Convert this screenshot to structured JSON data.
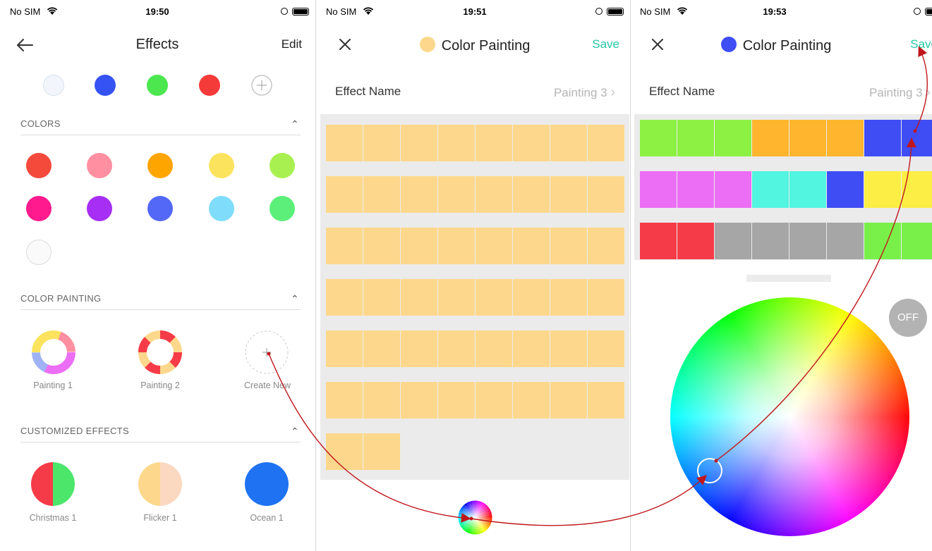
{
  "screen1": {
    "status": {
      "carrier": "No SIM",
      "time": "19:50"
    },
    "nav": {
      "title": "Effects",
      "edit_label": "Edit"
    },
    "top_swatches": [
      "#f2f6fc",
      "#3553f3",
      "#4ce64f",
      "#f53a3a"
    ],
    "colors_section": {
      "title": "COLORS"
    },
    "colors": [
      "#f44a3b",
      "#ff8fa1",
      "#ffa500",
      "#fbe35e",
      "#a8f050",
      "#ff1a8d",
      "#a62ef5",
      "#5468f8",
      "#7fdcfa",
      "#5cf07a",
      "#fafafa"
    ],
    "painting_section": {
      "title": "COLOR PAINTING"
    },
    "paintings": [
      {
        "label": "Painting 1"
      },
      {
        "label": "Painting 2"
      },
      {
        "label": "Create New"
      }
    ],
    "customized_section": {
      "title": "CUSTOMIZED EFFECTS"
    },
    "customized": [
      {
        "label": "Christmas 1"
      },
      {
        "label": "Flicker 1"
      },
      {
        "label": "Ocean 1"
      }
    ]
  },
  "screen2": {
    "status": {
      "carrier": "No SIM",
      "time": "19:51"
    },
    "nav": {
      "title": "Color Painting",
      "save_label": "Save",
      "dot_color": "#fdd88c"
    },
    "effect_name": {
      "label": "Effect Name",
      "value": "Painting 3"
    },
    "cell_color": "#fdd88c"
  },
  "screen3": {
    "status": {
      "carrier": "No SIM",
      "time": "19:53"
    },
    "nav": {
      "title": "Color Painting",
      "save_label": "Save",
      "dot_color": "#3f4df5"
    },
    "effect_name": {
      "label": "Effect Name",
      "value": "Painting 3"
    },
    "strips": [
      [
        "#8df144",
        "#8df144",
        "#8df144",
        "#ffb52e",
        "#ffb52e",
        "#ffb52e",
        "#3f4df5",
        "#3f4df5"
      ],
      [
        "#ec6ef5",
        "#ec6ef5",
        "#ec6ef5",
        "#52f5e0",
        "#52f5e0",
        "#3f4df5",
        "#fcee44",
        "#fcee44"
      ],
      [
        "#f63b48",
        "#f63b48",
        "#a6a6a6",
        "#a6a6a6",
        "#a6a6a6",
        "#a6a6a6",
        "#79f04a",
        "#79f04a"
      ]
    ],
    "off_label": "OFF"
  },
  "colors": {
    "accent": "#27c6a6",
    "arrow": "#c0161b"
  }
}
